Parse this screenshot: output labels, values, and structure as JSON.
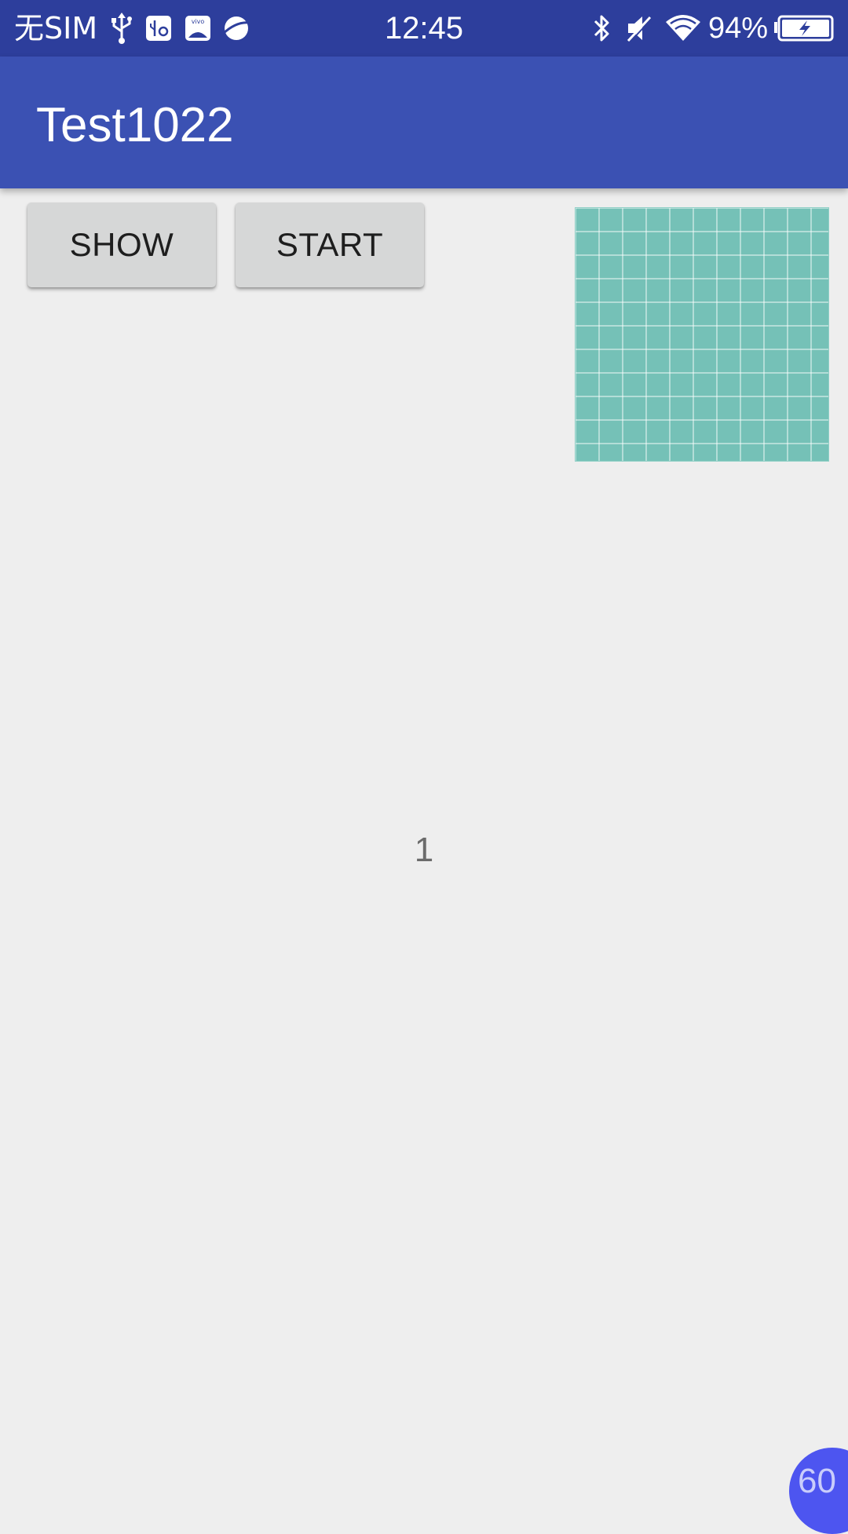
{
  "status_bar": {
    "carrier": "无SIM",
    "time": "12:45",
    "battery_percent": "94%",
    "icons": [
      "usb-icon",
      "usb-debug-icon",
      "vivo-app-icon",
      "browser-icon",
      "bluetooth-icon",
      "mute-icon",
      "wifi-icon",
      "battery-charging-icon"
    ],
    "background": "#2d3e9c"
  },
  "app_bar": {
    "title": "Test1022",
    "background": "#3b51b3"
  },
  "buttons": {
    "show_label": "SHOW",
    "start_label": "START"
  },
  "content": {
    "counter": "1",
    "image_color": "#75c1b7"
  },
  "fps_overlay": {
    "value": "60",
    "color": "#4d55f0"
  }
}
